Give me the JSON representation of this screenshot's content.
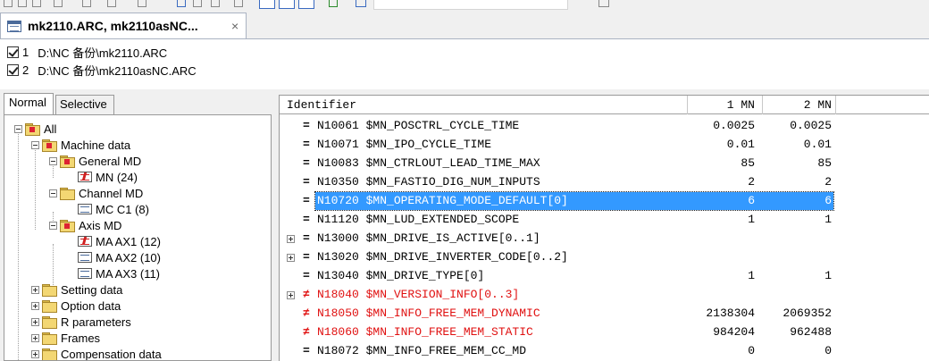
{
  "document_tab": {
    "title": "mk2110.ARC, mk2110asNC...",
    "close_glyph": "×"
  },
  "files": [
    {
      "index": "1",
      "path": "D:\\NC 备份\\mk2110.ARC",
      "checked": true
    },
    {
      "index": "2",
      "path": "D:\\NC 备份\\mk2110asNC.ARC",
      "checked": true
    }
  ],
  "left_tabs": {
    "normal": "Normal",
    "selective": "Selective"
  },
  "tree": {
    "all": "All",
    "machine_data": "Machine data",
    "general_md": "General MD",
    "mn": "MN (24)",
    "channel_md": "Channel MD",
    "mc_c1": "MC C1 (8)",
    "axis_md": "Axis MD",
    "ma_ax1": "MA AX1 (12)",
    "ma_ax2": "MA AX2 (10)",
    "ma_ax3": "MA AX3 (11)",
    "setting_data": "Setting data",
    "option_data": "Option data",
    "r_parameters": "R parameters",
    "frames": "Frames",
    "compensation_data": "Compensation data"
  },
  "grid": {
    "headers": {
      "identifier": "Identifier",
      "col1": "1 MN",
      "col2": "2 MN"
    },
    "rows": [
      {
        "sym": "=",
        "id": "N10061 $MN_POSCTRL_CYCLE_TIME",
        "v1": "0.0025",
        "v2": "0.0025"
      },
      {
        "sym": "=",
        "id": "N10071 $MN_IPO_CYCLE_TIME",
        "v1": "0.01",
        "v2": "0.01"
      },
      {
        "sym": "=",
        "id": "N10083 $MN_CTRLOUT_LEAD_TIME_MAX",
        "v1": "85",
        "v2": "85"
      },
      {
        "sym": "=",
        "id": "N10350 $MN_FASTIO_DIG_NUM_INPUTS",
        "v1": "2",
        "v2": "2"
      },
      {
        "sym": "=",
        "id": "N10720 $MN_OPERATING_MODE_DEFAULT[0]",
        "v1": "6",
        "v2": "6"
      },
      {
        "sym": "=",
        "id": "N11120 $MN_LUD_EXTENDED_SCOPE",
        "v1": "1",
        "v2": "1"
      },
      {
        "sym": "=",
        "id": "N13000 $MN_DRIVE_IS_ACTIVE[0..1]",
        "v1": "",
        "v2": ""
      },
      {
        "sym": "=",
        "id": "N13020 $MN_DRIVE_INVERTER_CODE[0..2]",
        "v1": "",
        "v2": ""
      },
      {
        "sym": "=",
        "id": "N13040 $MN_DRIVE_TYPE[0]",
        "v1": "1",
        "v2": "1"
      },
      {
        "sym": "≠",
        "id": "N18040 $MN_VERSION_INFO[0..3]",
        "v1": "",
        "v2": ""
      },
      {
        "sym": "≠",
        "id": "N18050 $MN_INFO_FREE_MEM_DYNAMIC",
        "v1": "2138304",
        "v2": "2069352"
      },
      {
        "sym": "≠",
        "id": "N18060 $MN_INFO_FREE_MEM_STATIC",
        "v1": "984204",
        "v2": "962488"
      },
      {
        "sym": "=",
        "id": "N18072 $MN_INFO_FREE_MEM_CC_MD",
        "v1": "0",
        "v2": "0"
      }
    ]
  },
  "colors": {
    "selection": "#3399ff",
    "diff": "#e01010"
  }
}
